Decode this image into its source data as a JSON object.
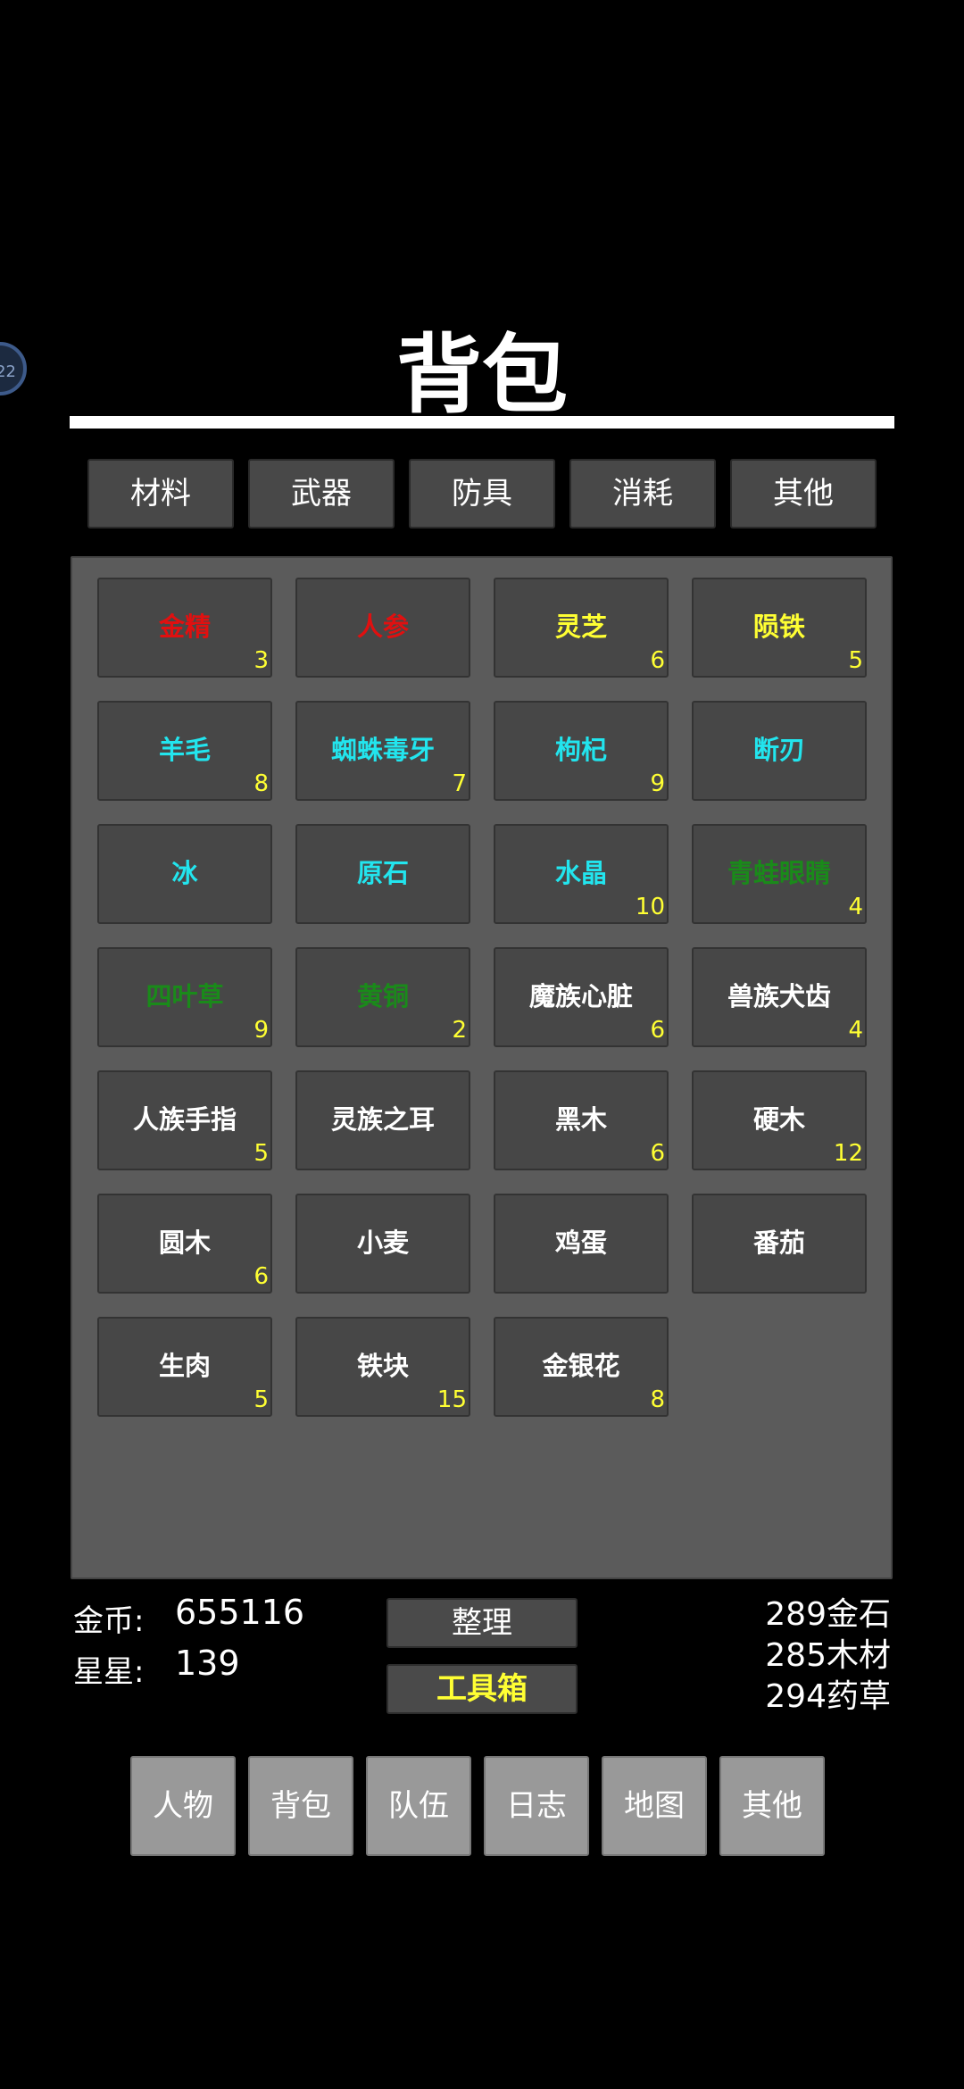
{
  "side_badge": "22",
  "title": "背包",
  "category_tabs": [
    "材料",
    "武器",
    "防具",
    "消耗",
    "其他"
  ],
  "items": [
    {
      "name": "金精",
      "qty": "3",
      "color": "#e01010"
    },
    {
      "name": "人参",
      "qty": "",
      "color": "#e01010"
    },
    {
      "name": "灵芝",
      "qty": "6",
      "color": "#ffff33"
    },
    {
      "name": "陨铁",
      "qty": "5",
      "color": "#ffff33"
    },
    {
      "name": "羊毛",
      "qty": "8",
      "color": "#22e5ee"
    },
    {
      "name": "蜘蛛毒牙",
      "qty": "7",
      "color": "#22e5ee"
    },
    {
      "name": "枸杞",
      "qty": "9",
      "color": "#22e5ee"
    },
    {
      "name": "断刃",
      "qty": "",
      "color": "#22e5ee"
    },
    {
      "name": "冰",
      "qty": "",
      "color": "#22e5ee"
    },
    {
      "name": "原石",
      "qty": "",
      "color": "#22e5ee"
    },
    {
      "name": "水晶",
      "qty": "10",
      "color": "#22e5ee"
    },
    {
      "name": "青蛙眼睛",
      "qty": "4",
      "color": "#1a8a1a"
    },
    {
      "name": "四叶草",
      "qty": "9",
      "color": "#1a8a1a"
    },
    {
      "name": "黄铜",
      "qty": "2",
      "color": "#1a8a1a"
    },
    {
      "name": "魔族心脏",
      "qty": "6",
      "color": "#ffffff"
    },
    {
      "name": "兽族犬齿",
      "qty": "4",
      "color": "#ffffff"
    },
    {
      "name": "人族手指",
      "qty": "5",
      "color": "#ffffff"
    },
    {
      "name": "灵族之耳",
      "qty": "",
      "color": "#ffffff"
    },
    {
      "name": "黑木",
      "qty": "6",
      "color": "#ffffff"
    },
    {
      "name": "硬木",
      "qty": "12",
      "color": "#ffffff"
    },
    {
      "name": "圆木",
      "qty": "6",
      "color": "#ffffff"
    },
    {
      "name": "小麦",
      "qty": "",
      "color": "#ffffff"
    },
    {
      "name": "鸡蛋",
      "qty": "",
      "color": "#ffffff"
    },
    {
      "name": "番茄",
      "qty": "",
      "color": "#ffffff"
    },
    {
      "name": "生肉",
      "qty": "5",
      "color": "#ffffff"
    },
    {
      "name": "铁块",
      "qty": "15",
      "color": "#ffffff"
    },
    {
      "name": "金银花",
      "qty": "8",
      "color": "#ffffff"
    }
  ],
  "stats": {
    "gold_label": "金币:",
    "gold_value": "655116",
    "stars_label": "星星:",
    "stars_value": "139"
  },
  "actions": {
    "sort_label": "整理",
    "toolbox_label": "工具箱",
    "toolbox_color": "#ffff33"
  },
  "resources": [
    "289金石",
    "285木材",
    "294药草"
  ],
  "bottom_nav": [
    "人物",
    "背包",
    "队伍",
    "日志",
    "地图",
    "其他"
  ]
}
